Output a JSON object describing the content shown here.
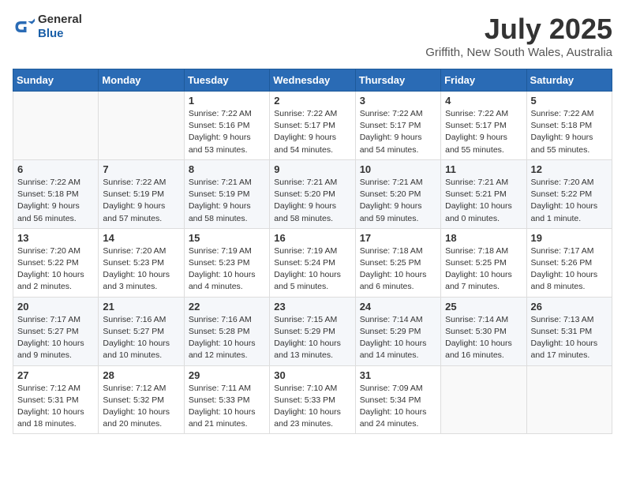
{
  "header": {
    "logo_line1": "General",
    "logo_line2": "Blue",
    "title": "July 2025",
    "subtitle": "Griffith, New South Wales, Australia"
  },
  "calendar": {
    "weekdays": [
      "Sunday",
      "Monday",
      "Tuesday",
      "Wednesday",
      "Thursday",
      "Friday",
      "Saturday"
    ],
    "weeks": [
      [
        {
          "day": "",
          "info": ""
        },
        {
          "day": "",
          "info": ""
        },
        {
          "day": "1",
          "info": "Sunrise: 7:22 AM\nSunset: 5:16 PM\nDaylight: 9 hours and 53 minutes."
        },
        {
          "day": "2",
          "info": "Sunrise: 7:22 AM\nSunset: 5:17 PM\nDaylight: 9 hours and 54 minutes."
        },
        {
          "day": "3",
          "info": "Sunrise: 7:22 AM\nSunset: 5:17 PM\nDaylight: 9 hours and 54 minutes."
        },
        {
          "day": "4",
          "info": "Sunrise: 7:22 AM\nSunset: 5:17 PM\nDaylight: 9 hours and 55 minutes."
        },
        {
          "day": "5",
          "info": "Sunrise: 7:22 AM\nSunset: 5:18 PM\nDaylight: 9 hours and 55 minutes."
        }
      ],
      [
        {
          "day": "6",
          "info": "Sunrise: 7:22 AM\nSunset: 5:18 PM\nDaylight: 9 hours and 56 minutes."
        },
        {
          "day": "7",
          "info": "Sunrise: 7:22 AM\nSunset: 5:19 PM\nDaylight: 9 hours and 57 minutes."
        },
        {
          "day": "8",
          "info": "Sunrise: 7:21 AM\nSunset: 5:19 PM\nDaylight: 9 hours and 58 minutes."
        },
        {
          "day": "9",
          "info": "Sunrise: 7:21 AM\nSunset: 5:20 PM\nDaylight: 9 hours and 58 minutes."
        },
        {
          "day": "10",
          "info": "Sunrise: 7:21 AM\nSunset: 5:20 PM\nDaylight: 9 hours and 59 minutes."
        },
        {
          "day": "11",
          "info": "Sunrise: 7:21 AM\nSunset: 5:21 PM\nDaylight: 10 hours and 0 minutes."
        },
        {
          "day": "12",
          "info": "Sunrise: 7:20 AM\nSunset: 5:22 PM\nDaylight: 10 hours and 1 minute."
        }
      ],
      [
        {
          "day": "13",
          "info": "Sunrise: 7:20 AM\nSunset: 5:22 PM\nDaylight: 10 hours and 2 minutes."
        },
        {
          "day": "14",
          "info": "Sunrise: 7:20 AM\nSunset: 5:23 PM\nDaylight: 10 hours and 3 minutes."
        },
        {
          "day": "15",
          "info": "Sunrise: 7:19 AM\nSunset: 5:23 PM\nDaylight: 10 hours and 4 minutes."
        },
        {
          "day": "16",
          "info": "Sunrise: 7:19 AM\nSunset: 5:24 PM\nDaylight: 10 hours and 5 minutes."
        },
        {
          "day": "17",
          "info": "Sunrise: 7:18 AM\nSunset: 5:25 PM\nDaylight: 10 hours and 6 minutes."
        },
        {
          "day": "18",
          "info": "Sunrise: 7:18 AM\nSunset: 5:25 PM\nDaylight: 10 hours and 7 minutes."
        },
        {
          "day": "19",
          "info": "Sunrise: 7:17 AM\nSunset: 5:26 PM\nDaylight: 10 hours and 8 minutes."
        }
      ],
      [
        {
          "day": "20",
          "info": "Sunrise: 7:17 AM\nSunset: 5:27 PM\nDaylight: 10 hours and 9 minutes."
        },
        {
          "day": "21",
          "info": "Sunrise: 7:16 AM\nSunset: 5:27 PM\nDaylight: 10 hours and 10 minutes."
        },
        {
          "day": "22",
          "info": "Sunrise: 7:16 AM\nSunset: 5:28 PM\nDaylight: 10 hours and 12 minutes."
        },
        {
          "day": "23",
          "info": "Sunrise: 7:15 AM\nSunset: 5:29 PM\nDaylight: 10 hours and 13 minutes."
        },
        {
          "day": "24",
          "info": "Sunrise: 7:14 AM\nSunset: 5:29 PM\nDaylight: 10 hours and 14 minutes."
        },
        {
          "day": "25",
          "info": "Sunrise: 7:14 AM\nSunset: 5:30 PM\nDaylight: 10 hours and 16 minutes."
        },
        {
          "day": "26",
          "info": "Sunrise: 7:13 AM\nSunset: 5:31 PM\nDaylight: 10 hours and 17 minutes."
        }
      ],
      [
        {
          "day": "27",
          "info": "Sunrise: 7:12 AM\nSunset: 5:31 PM\nDaylight: 10 hours and 18 minutes."
        },
        {
          "day": "28",
          "info": "Sunrise: 7:12 AM\nSunset: 5:32 PM\nDaylight: 10 hours and 20 minutes."
        },
        {
          "day": "29",
          "info": "Sunrise: 7:11 AM\nSunset: 5:33 PM\nDaylight: 10 hours and 21 minutes."
        },
        {
          "day": "30",
          "info": "Sunrise: 7:10 AM\nSunset: 5:33 PM\nDaylight: 10 hours and 23 minutes."
        },
        {
          "day": "31",
          "info": "Sunrise: 7:09 AM\nSunset: 5:34 PM\nDaylight: 10 hours and 24 minutes."
        },
        {
          "day": "",
          "info": ""
        },
        {
          "day": "",
          "info": ""
        }
      ]
    ]
  }
}
